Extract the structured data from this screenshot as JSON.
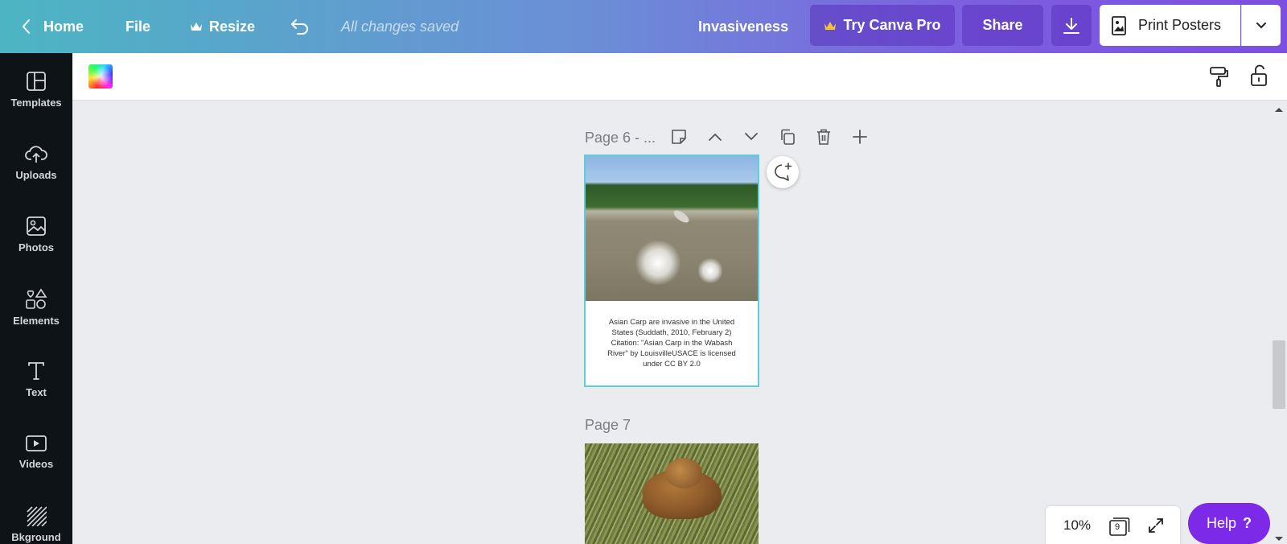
{
  "topbar": {
    "home_label": "Home",
    "file_label": "File",
    "resize_label": "Resize",
    "saved_status": "All changes saved",
    "doc_title": "Invasiveness",
    "try_pro_label": "Try Canva Pro",
    "share_label": "Share",
    "print_label": "Print Posters"
  },
  "sidebar": {
    "items": [
      {
        "label": "Templates",
        "icon": "templates-icon"
      },
      {
        "label": "Uploads",
        "icon": "upload-cloud-icon"
      },
      {
        "label": "Photos",
        "icon": "photos-icon"
      },
      {
        "label": "Elements",
        "icon": "elements-icon"
      },
      {
        "label": "Text",
        "icon": "text-icon"
      },
      {
        "label": "Videos",
        "icon": "videos-icon"
      },
      {
        "label": "Bkground",
        "icon": "background-icon"
      }
    ]
  },
  "canvas": {
    "page6_title": "Page 6 - ...",
    "page6_caption": "Asian Carp are invasive in the United States (Suddath, 2010, February 2) Citation: \"Asian Carp in the Wabash River\" by LouisvilleUSACE is licensed under CC BY 2.0",
    "page7_title": "Page 7"
  },
  "bottom": {
    "zoom": "10%",
    "page_count": "9",
    "help_label": "Help",
    "help_symbol": "?"
  },
  "colors": {
    "accent_purple": "#7d2ae8",
    "selection_border": "#5ccfda",
    "sidebar_bg": "#0e1318"
  }
}
